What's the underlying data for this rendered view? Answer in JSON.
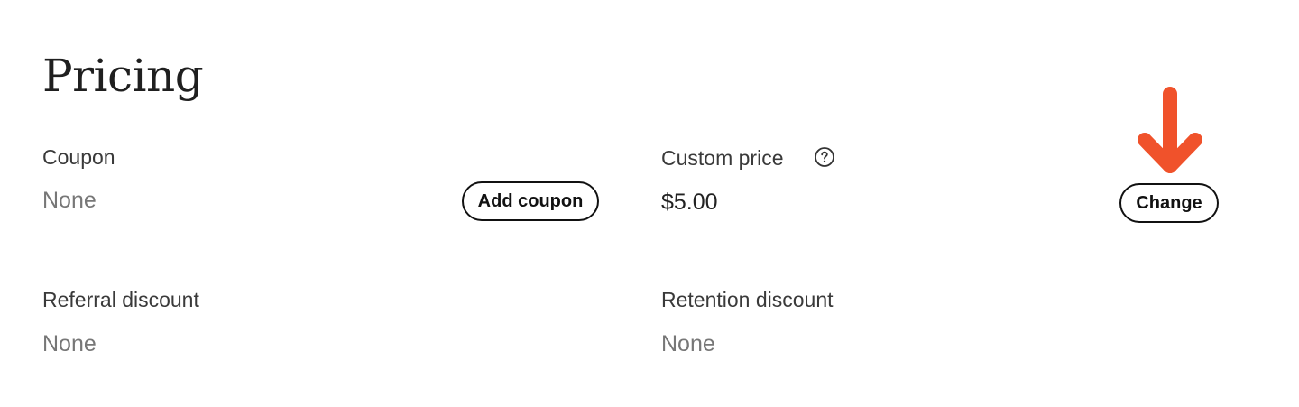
{
  "page": {
    "title": "Pricing"
  },
  "coupon": {
    "label": "Coupon",
    "value": "None",
    "button_label": "Add coupon"
  },
  "custom_price": {
    "label": "Custom price",
    "value": "$5.00",
    "button_label": "Change",
    "help_icon": "question-circle-icon"
  },
  "referral_discount": {
    "label": "Referral discount",
    "value": "None"
  },
  "retention_discount": {
    "label": "Retention discount",
    "value": "None"
  },
  "annotation": {
    "icon": "arrow-down-icon",
    "color": "#F0522B"
  }
}
